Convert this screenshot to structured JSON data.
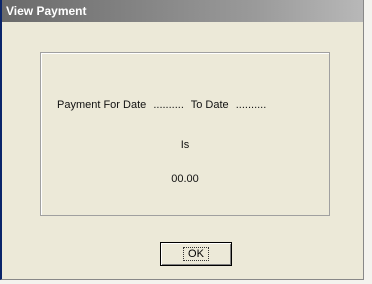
{
  "window": {
    "title": "View Payment"
  },
  "panel": {
    "payment_for_date_label": "Payment For Date",
    "from_date_value": "..........",
    "to_date_label": "To Date",
    "to_date_value": "..........",
    "is_label": "Is",
    "amount": "00.00"
  },
  "buttons": {
    "ok_label": "OK"
  }
}
